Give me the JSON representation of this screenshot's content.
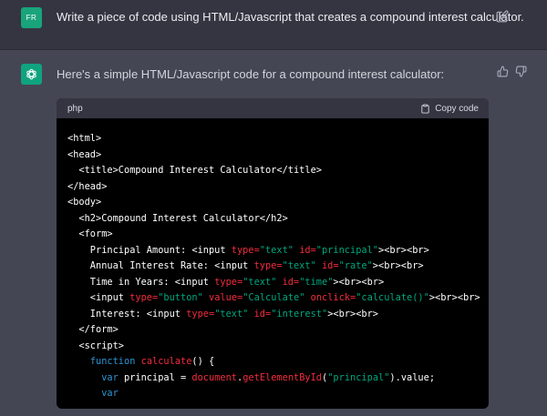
{
  "user": {
    "avatar_text": "FR",
    "message": "Write a piece of code using HTML/Javascript that creates a compound interest calculator."
  },
  "assistant": {
    "message": "Here's a simple HTML/Javascript code for a compound interest calculator:"
  },
  "code_block": {
    "language": "php",
    "copy_label": "Copy code",
    "lines": [
      [
        [
          "p",
          "<html>"
        ]
      ],
      [
        [
          "p",
          "<head>"
        ]
      ],
      [
        [
          "p",
          "  <title>Compound Interest Calculator</title>"
        ]
      ],
      [
        [
          "p",
          "</head>"
        ]
      ],
      [
        [
          "p",
          "<body>"
        ]
      ],
      [
        [
          "p",
          "  <h2>Compound Interest Calculator</h2>"
        ]
      ],
      [
        [
          "p",
          "  <form>"
        ]
      ],
      [
        [
          "p",
          "    Principal Amount: <input "
        ],
        [
          "a",
          "type="
        ],
        [
          "s",
          "\"text\""
        ],
        [
          "p",
          " "
        ],
        [
          "a",
          "id="
        ],
        [
          "s",
          "\"principal\""
        ],
        [
          "p",
          "><br><br>"
        ]
      ],
      [
        [
          "p",
          "    Annual Interest Rate: <input "
        ],
        [
          "a",
          "type="
        ],
        [
          "s",
          "\"text\""
        ],
        [
          "p",
          " "
        ],
        [
          "a",
          "id="
        ],
        [
          "s",
          "\"rate\""
        ],
        [
          "p",
          "><br><br>"
        ]
      ],
      [
        [
          "p",
          "    Time in Years: <input "
        ],
        [
          "a",
          "type="
        ],
        [
          "s",
          "\"text\""
        ],
        [
          "p",
          " "
        ],
        [
          "a",
          "id="
        ],
        [
          "s",
          "\"time\""
        ],
        [
          "p",
          "><br><br>"
        ]
      ],
      [
        [
          "p",
          "    <input "
        ],
        [
          "a",
          "type="
        ],
        [
          "s",
          "\"button\""
        ],
        [
          "p",
          " "
        ],
        [
          "a",
          "value="
        ],
        [
          "s",
          "\"Calculate\""
        ],
        [
          "p",
          " "
        ],
        [
          "a",
          "onclick="
        ],
        [
          "s",
          "\"calculate()\""
        ],
        [
          "p",
          "><br><br>"
        ]
      ],
      [
        [
          "p",
          "    Interest: <input "
        ],
        [
          "a",
          "type="
        ],
        [
          "s",
          "\"text\""
        ],
        [
          "p",
          " "
        ],
        [
          "a",
          "id="
        ],
        [
          "s",
          "\"interest\""
        ],
        [
          "p",
          "><br><br>"
        ]
      ],
      [
        [
          "p",
          "  </form>"
        ]
      ],
      [
        [
          "p",
          "  <script>"
        ]
      ],
      [
        [
          "p",
          "    "
        ],
        [
          "k",
          "function"
        ],
        [
          "p",
          " "
        ],
        [
          "f",
          "calculate"
        ],
        [
          "p",
          "() {"
        ]
      ],
      [
        [
          "p",
          "      "
        ],
        [
          "k",
          "var"
        ],
        [
          "p",
          " principal = "
        ],
        [
          "f",
          "document"
        ],
        [
          "p",
          "."
        ],
        [
          "f",
          "getElementById"
        ],
        [
          "p",
          "("
        ],
        [
          "s",
          "\"principal\""
        ],
        [
          "p",
          ").value;"
        ]
      ],
      [
        [
          "p",
          "      "
        ],
        [
          "k",
          "var"
        ]
      ]
    ]
  },
  "colors": {
    "user_bg": "#343541",
    "assistant_bg": "#444654",
    "code_bg": "#000000",
    "attr": "#f22c3d",
    "string": "#00a67d",
    "keyword": "#2e95d3"
  }
}
